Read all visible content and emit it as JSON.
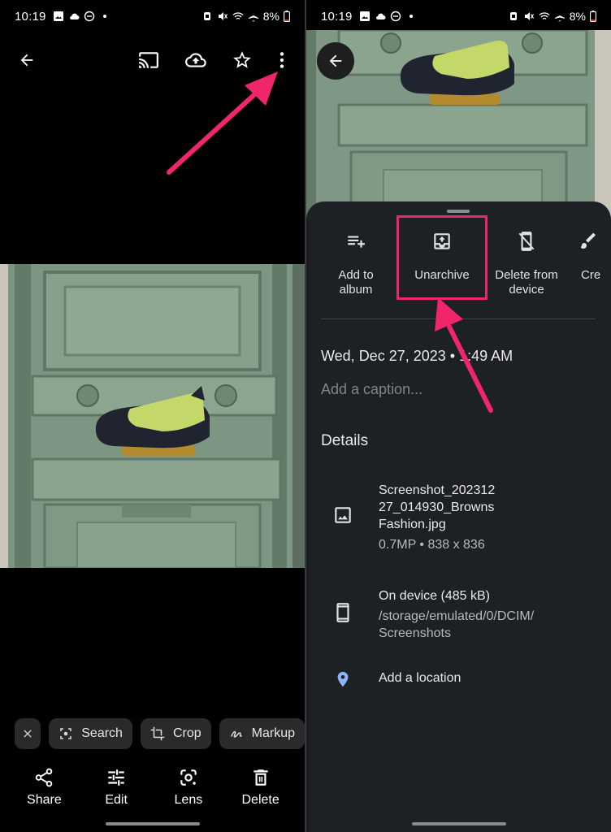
{
  "colors": {
    "accent": "#f0266a",
    "link": "#8ab4f8",
    "sheet_bg": "#1d2125",
    "chip_bg": "#2a2a2a"
  },
  "left": {
    "status": {
      "time": "10:19",
      "battery": "8%"
    },
    "topbar_icons": [
      "back-arrow-icon",
      "cast-icon",
      "cloud-upload-icon",
      "star-icon",
      "more-vert-icon"
    ],
    "chips": [
      {
        "icon": "close-icon",
        "label": ""
      },
      {
        "icon": "lens-search-icon",
        "label": "Search"
      },
      {
        "icon": "crop-icon",
        "label": "Crop"
      },
      {
        "icon": "markup-icon",
        "label": "Markup"
      }
    ],
    "actions": [
      {
        "icon": "share-icon",
        "label": "Share"
      },
      {
        "icon": "edit-sliders-icon",
        "label": "Edit"
      },
      {
        "icon": "lens-icon",
        "label": "Lens"
      },
      {
        "icon": "trash-icon",
        "label": "Delete"
      }
    ]
  },
  "right": {
    "status": {
      "time": "10:19",
      "battery": "8%"
    },
    "sheet_actions": [
      {
        "icon": "add-to-playlist-icon",
        "label": "Add to album"
      },
      {
        "icon": "unarchive-icon",
        "label": "Unarchive"
      },
      {
        "icon": "phone-erase-icon",
        "label": "Delete from device"
      },
      {
        "icon": "brush-icon",
        "label": "Cre"
      }
    ],
    "date": "Wed, Dec 27, 2023 • 1:49 AM",
    "caption_placeholder": "Add a caption...",
    "details_heading": "Details",
    "file": {
      "name": "Screenshot_20231227_014930_BrownsFashion.jpg",
      "name_lines": [
        "Screenshot_202312",
        "27_014930_Browns",
        "Fashion.jpg"
      ],
      "meta": "0.7MP  •  838 x 836"
    },
    "storage": {
      "title": "On device (485 kB)",
      "path_lines": [
        "/storage/emulated/0/DCIM/",
        "Screenshots"
      ]
    },
    "location_label": "Add a location"
  }
}
